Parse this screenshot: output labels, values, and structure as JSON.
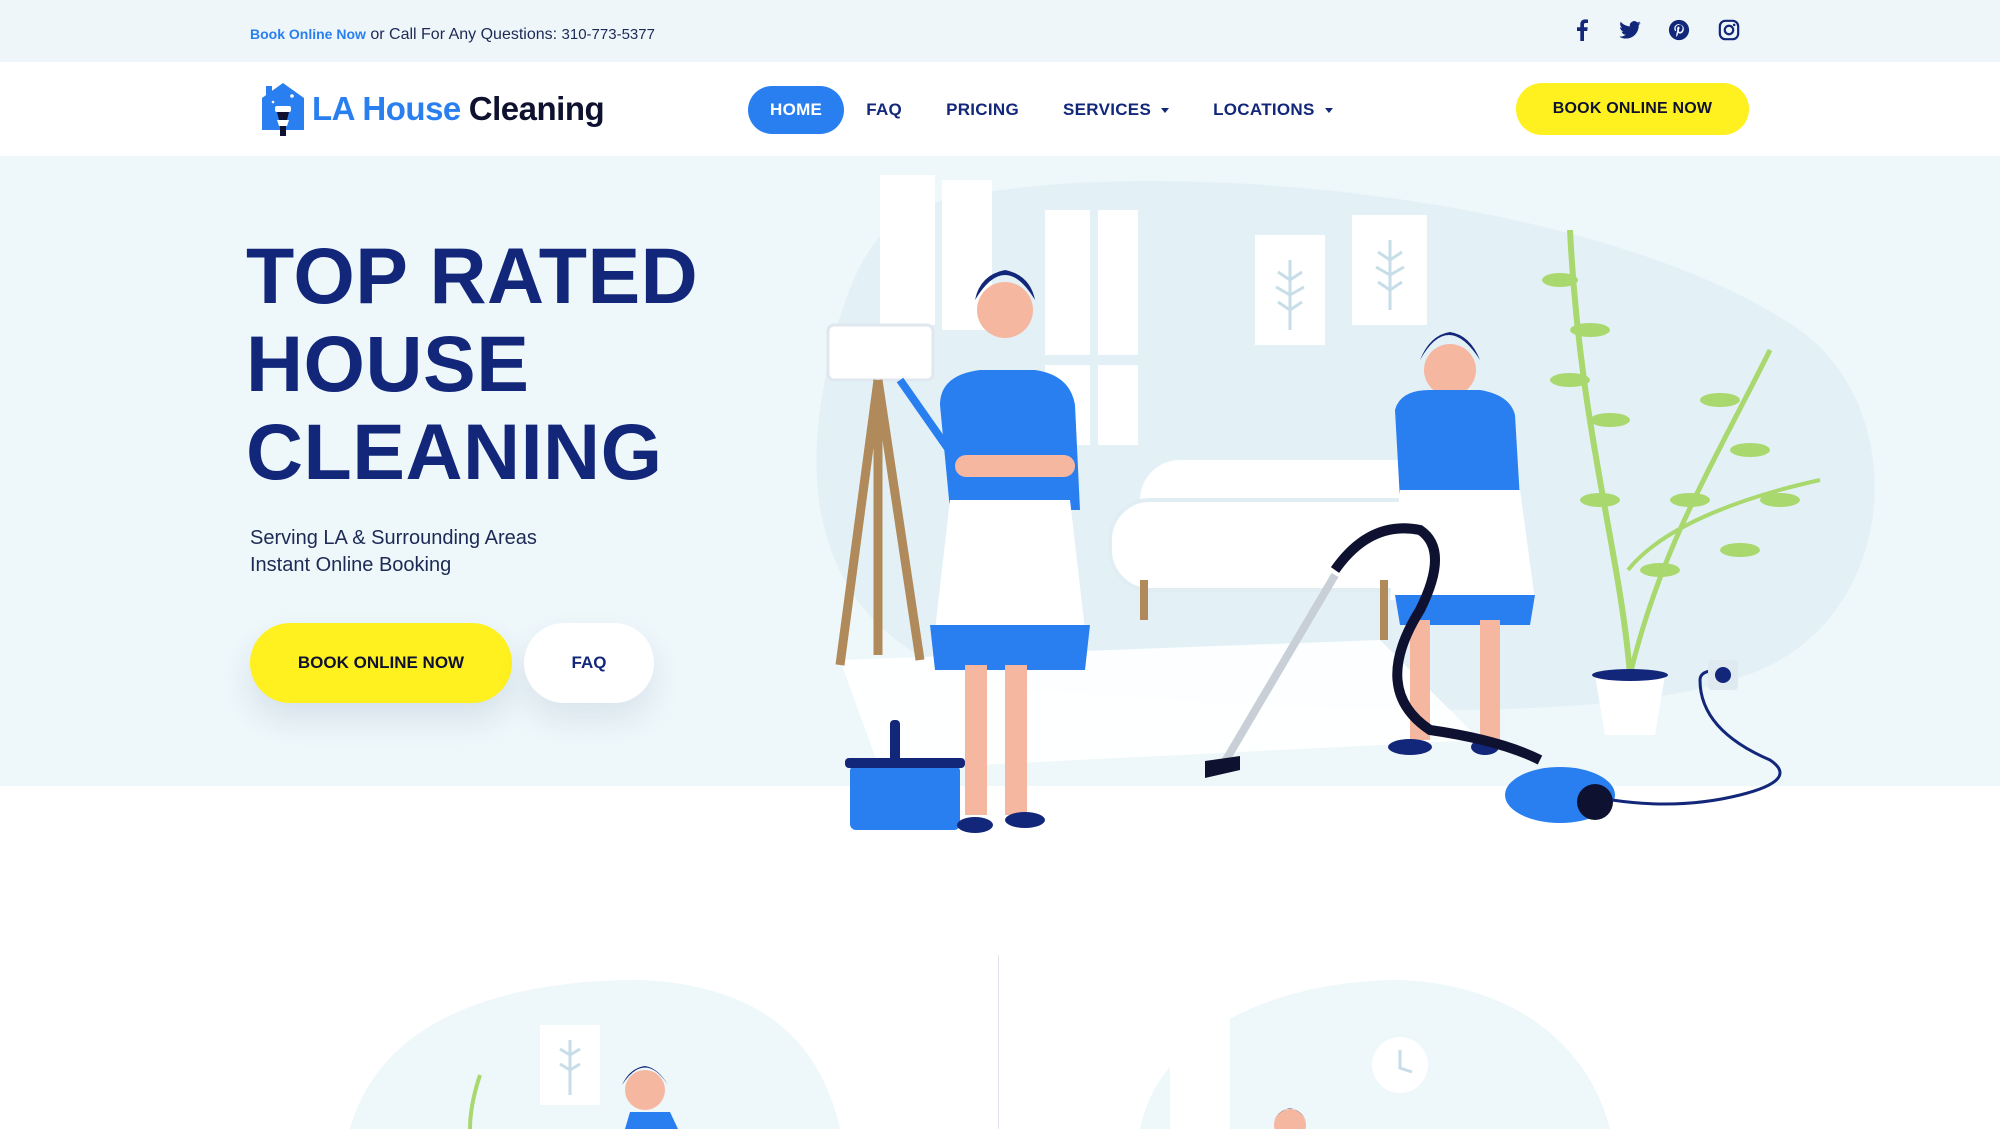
{
  "topbar": {
    "book_link": "Book Online Now",
    "call_text": " or Call For Any Questions: ",
    "phone": "310-773-5377",
    "social": [
      "facebook-icon",
      "twitter-icon",
      "pinterest-icon",
      "instagram-icon"
    ]
  },
  "header": {
    "logo_blue": "LA House",
    "logo_dark": "Cleaning",
    "nav": [
      {
        "label": "HOME",
        "active": true
      },
      {
        "label": "FAQ"
      },
      {
        "label": "PRICING"
      },
      {
        "label": "SERVICES",
        "dropdown": true
      },
      {
        "label": "LOCATIONS",
        "dropdown": true
      }
    ],
    "cta": "BOOK ONLINE NOW"
  },
  "hero": {
    "title_lines": [
      "TOP RATED",
      "HOUSE",
      "CLEANING"
    ],
    "subtitle_lines": [
      "Serving LA & Surrounding Areas",
      "Instant Online Booking"
    ],
    "primary_button": "BOOK ONLINE NOW",
    "secondary_button": "FAQ"
  },
  "colors": {
    "accent_blue": "#2a7ff0",
    "navy": "#13277a",
    "yellow": "#fff01f",
    "hero_bg": "#eef7fa"
  }
}
